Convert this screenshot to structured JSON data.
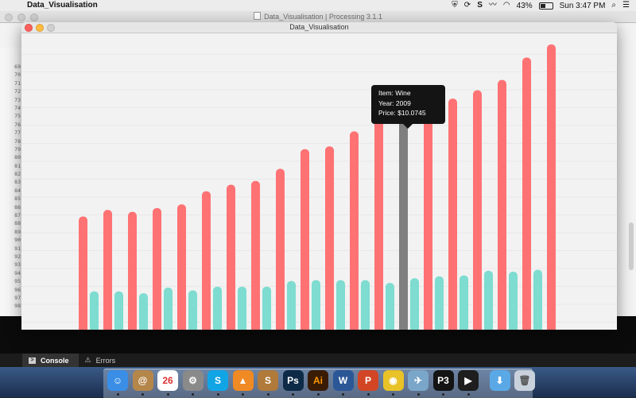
{
  "menubar": {
    "app_name": "Data_Visualisation",
    "clock": "Sun 3:47 PM",
    "battery_percent": "43%",
    "battery_level": 0.43,
    "icons": [
      "apple-icon",
      "shield-icon",
      "refresh-icon",
      "skype-icon",
      "activity-icon",
      "wifi-icon",
      "battery-icon",
      "search-icon",
      "list-icon"
    ]
  },
  "ide": {
    "window_title": "Data_Visualisation | Processing 3.1.1",
    "line_numbers": [
      "69",
      "70",
      "71",
      "72",
      "73",
      "74",
      "75",
      "76",
      "77",
      "78",
      "79",
      "80",
      "81",
      "82",
      "83",
      "84",
      "85",
      "86",
      "87",
      "88",
      "89",
      "90",
      "91",
      "92",
      "93",
      "94",
      "95",
      "96",
      "97",
      "98"
    ],
    "tabs": [
      {
        "label": "Console",
        "icon": "console-icon"
      },
      {
        "label": "Errors",
        "icon": "warning-icon"
      }
    ]
  },
  "sketch": {
    "window_title": "Data_Visualisation"
  },
  "tooltip": {
    "item": "Item: Wine",
    "year": "Year: 2009",
    "price": "Price: $10.0745"
  },
  "colors": {
    "series_a": "#ff7274",
    "series_b": "#7edcd0",
    "highlight": "#7f7f7f",
    "background": "#f2f2f2"
  },
  "chart_data": {
    "type": "bar",
    "title": "",
    "xlabel": "",
    "ylabel": "",
    "grid": true,
    "highlighted_index": 13,
    "series": [
      {
        "values": [
          121,
          128,
          126,
          130,
          134,
          148,
          155,
          159,
          172,
          193,
          196,
          212,
          235,
          251,
          239,
          247,
          256,
          267,
          291,
          305
        ]
      },
      {
        "values": [
          41,
          41,
          39,
          45,
          42,
          46,
          46,
          46,
          52,
          53,
          53,
          53,
          50,
          55,
          57,
          58,
          63,
          62,
          64
        ]
      }
    ],
    "ylim": [
      0,
      320
    ]
  },
  "dock": {
    "apps": [
      {
        "name": "finder-icon",
        "glyph": "☺",
        "color": "#3a8ee6"
      },
      {
        "name": "contacts-icon",
        "glyph": "@",
        "color": "#b5864a"
      },
      {
        "name": "calendar-icon",
        "glyph": "26",
        "color": "#ffffff",
        "text": "#d33"
      },
      {
        "name": "preferences-icon",
        "glyph": "⚙",
        "color": "#8a8a8a"
      },
      {
        "name": "skype-icon",
        "glyph": "S",
        "color": "#12a5e6"
      },
      {
        "name": "vlc-icon",
        "glyph": "▲",
        "color": "#f08a24"
      },
      {
        "name": "scrivener-icon",
        "glyph": "S",
        "color": "#b07a3a"
      },
      {
        "name": "photoshop-icon",
        "glyph": "Ps",
        "color": "#0d2a46"
      },
      {
        "name": "illustrator-icon",
        "glyph": "Ai",
        "color": "#3a1c06",
        "text": "#ff9a00"
      },
      {
        "name": "word-icon",
        "glyph": "W",
        "color": "#2b5797"
      },
      {
        "name": "powerpoint-icon",
        "glyph": "P",
        "color": "#d24625"
      },
      {
        "name": "chrome-icon",
        "glyph": "◉",
        "color": "#e8c227"
      },
      {
        "name": "preview-icon",
        "glyph": "✈",
        "color": "#7aa6c9"
      },
      {
        "name": "processing-icon",
        "glyph": "P3",
        "color": "#141414"
      },
      {
        "name": "quicktime-icon",
        "glyph": "▶",
        "color": "#1e1e1e"
      },
      {
        "name": "downloads-folder-icon",
        "glyph": "⬇",
        "color": "#5aa9e6"
      },
      {
        "name": "trash-icon",
        "glyph": "🗑",
        "color": "#c9d2dc",
        "text": "#555"
      }
    ]
  }
}
